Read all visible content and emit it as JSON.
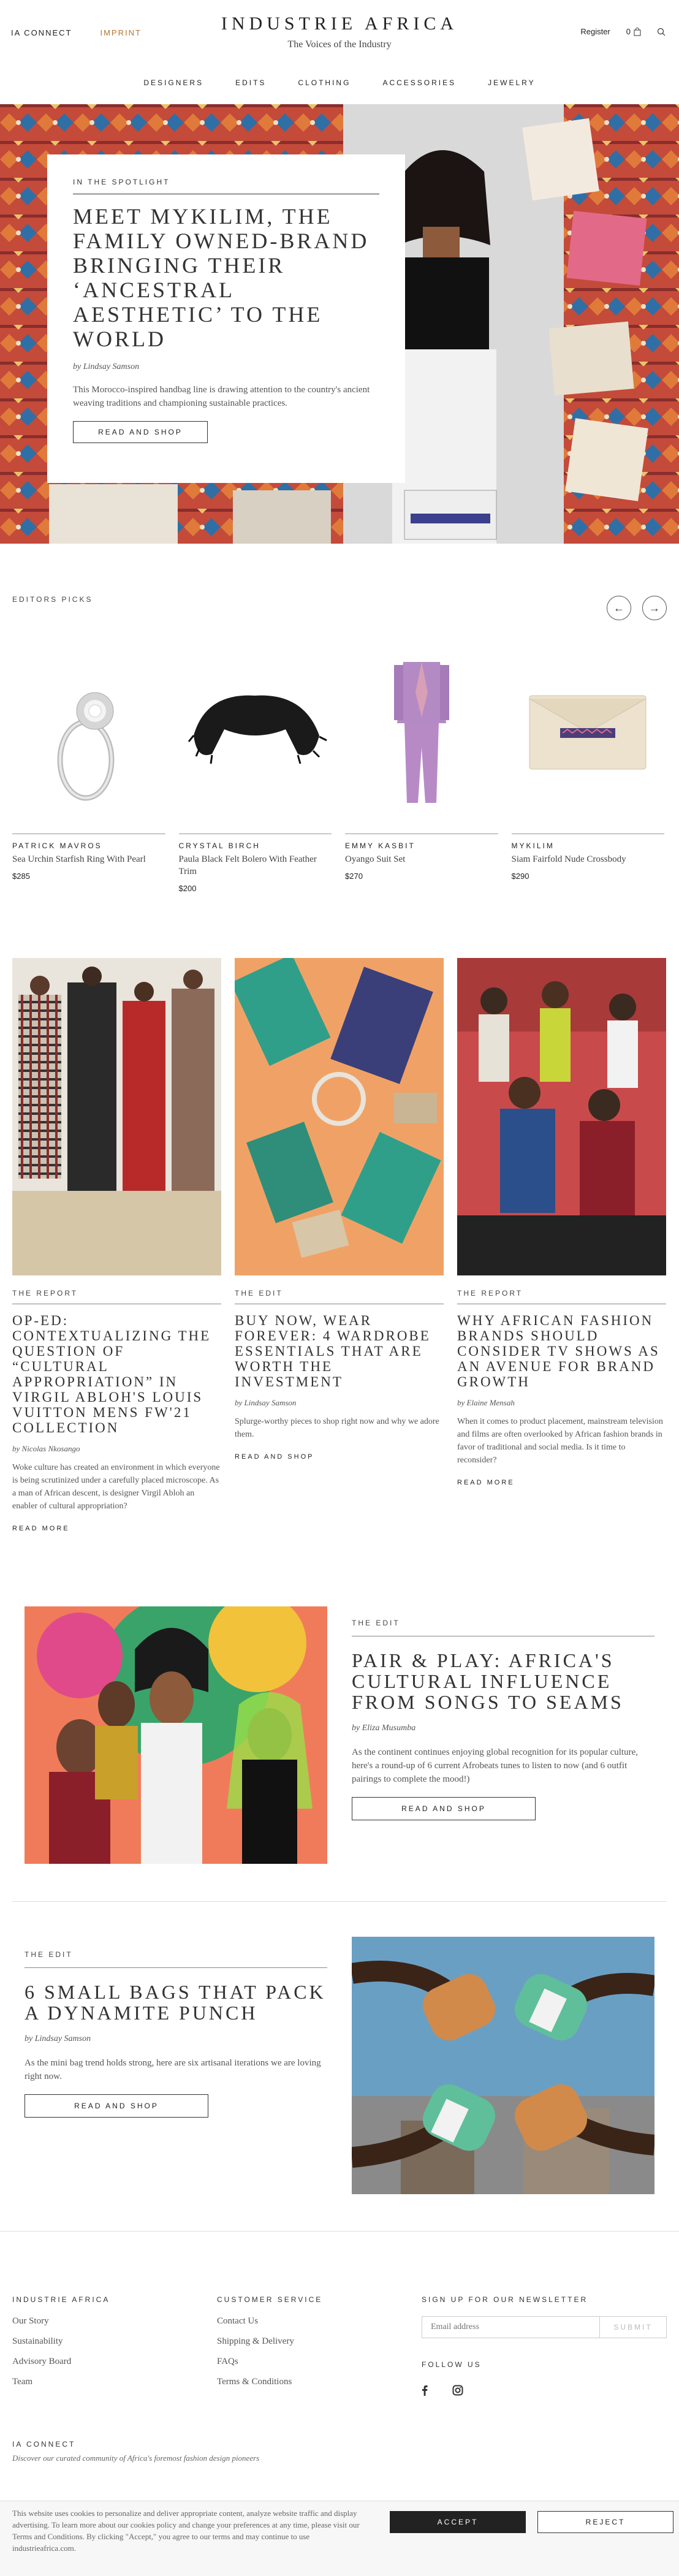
{
  "header": {
    "ia_connect": "IA CONNECT",
    "imprint": "IMPRINT",
    "logo": "INDUSTRIE AFRICA",
    "tagline": "The Voices of the Industry",
    "register": "Register",
    "cart_count": "0"
  },
  "nav": [
    "DESIGNERS",
    "EDITS",
    "CLOTHING",
    "ACCESSORIES",
    "JEWELRY"
  ],
  "hero": {
    "kicker": "IN THE SPOTLIGHT",
    "title": "MEET MYKILIM, THE FAMILY OWNED-BRAND BRINGING THEIR ‘ANCESTRAL AESTHETIC’ TO THE WORLD",
    "byline": "by Lindsay Samson",
    "deck": "This Morocco-inspired handbag line is drawing attention to the country's ancient weaving traditions and championing sustainable practices.",
    "button": "READ AND SHOP"
  },
  "picks": {
    "label": "EDITORS PICKS",
    "items": [
      {
        "brand": "PATRICK MAVROS",
        "name": "Sea Urchin Starfish Ring With Pearl",
        "price": "$285"
      },
      {
        "brand": "CRYSTAL BIRCH",
        "name": "Paula Black Felt Bolero With Feather Trim",
        "price": "$200"
      },
      {
        "brand": "EMMY KASBIT",
        "name": "Oyango Suit Set",
        "price": "$270"
      },
      {
        "brand": "MYKILIM",
        "name": "Siam Fairfold Nude Crossbody",
        "price": "$290"
      }
    ]
  },
  "articles": [
    {
      "kicker": "THE REPORT",
      "title": "OP-ED: CONTEXTUALIZING THE QUESTION OF “CULTURAL APPROPRIATION” IN VIRGIL ABLOH'S LOUIS VUITTON MENS FW'21 COLLECTION",
      "byline": "by Nicolas Nkosango",
      "deck": "Woke culture has created an environment in which everyone is being scrutinized under a carefully placed microscope. As a man of African descent, is designer Virgil Abloh an enabler of cultural appropriation?",
      "more": "READ MORE"
    },
    {
      "kicker": "THE EDIT",
      "title": "BUY NOW, WEAR FOREVER: 4 WARDROBE ESSENTIALS THAT ARE WORTH THE INVESTMENT",
      "byline": "by Lindsay Samson",
      "deck": "Splurge-worthy pieces to shop right now and why we adore them.",
      "more": "READ AND SHOP"
    },
    {
      "kicker": "THE REPORT",
      "title": "WHY AFRICAN FASHION BRANDS SHOULD CONSIDER TV SHOWS AS AN AVENUE FOR BRAND GROWTH",
      "byline": "by Elaine Mensah",
      "deck": "When it comes to product placement, mainstream television and films are often overlooked by African fashion brands in favor of traditional and social media. Is it time to reconsider?",
      "more": "READ MORE"
    }
  ],
  "feature1": {
    "kicker": "THE EDIT",
    "title": "PAIR & PLAY: AFRICA'S CULTURAL INFLUENCE FROM SONGS TO SEAMS",
    "byline": "by Eliza Musumba",
    "deck": "As the continent continues enjoying global recognition for its popular culture, here's a round-up of 6 current Afrobeats tunes to listen to now (and 6 outfit pairings to complete the mood!)",
    "button": "READ AND SHOP"
  },
  "feature2": {
    "kicker": "THE EDIT",
    "title": "6 SMALL BAGS THAT PACK A DYNAMITE PUNCH",
    "byline": "by Lindsay Samson",
    "deck": "As the mini bag trend holds strong, here are six artisanal iterations we are loving right now.",
    "button": "READ AND SHOP"
  },
  "footer": {
    "col1": {
      "head": "INDUSTRIE AFRICA",
      "links": [
        "Our Story",
        "Sustainability",
        "Advisory Board",
        "Team"
      ]
    },
    "col2": {
      "head": "CUSTOMER SERVICE",
      "links": [
        "Contact Us",
        "Shipping & Delivery",
        "FAQs",
        "Terms & Conditions"
      ]
    },
    "newsletter": {
      "head": "SIGN UP FOR OUR NEWSLETTER",
      "placeholder": "Email address",
      "submit": "SUBMIT"
    },
    "follow": "FOLLOW US",
    "ia_connect": {
      "title": "IA CONNECT",
      "desc": "Discover our curated community of Africa's foremost fashion design pioneers"
    }
  },
  "cookie": {
    "message": "This website uses cookies to personalize and deliver appropriate content, analyze website traffic and display advertising. To learn more about our cookies policy and change your preferences at any time, please visit our Terms and Conditions. By clicking \"Accept,\" you agree to our terms and may continue to use industrieafrica.com.",
    "accept": "ACCEPT",
    "reject": "REJECT"
  },
  "colors": {
    "accent": "#b5742f",
    "text": "#222222",
    "dark_button": "#222222"
  }
}
